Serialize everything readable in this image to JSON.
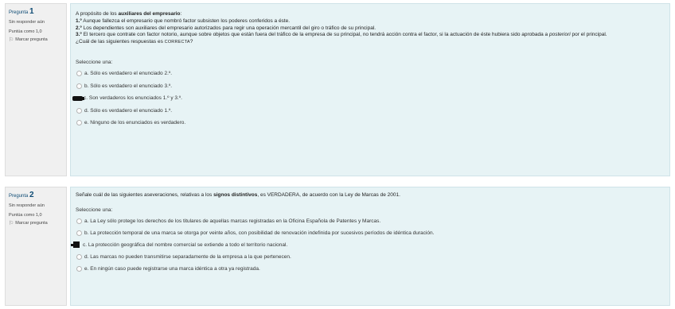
{
  "question1": {
    "number_prefix": "Pregunta",
    "number": "1",
    "status": "Sin responder aún",
    "points": "Puntúa como 1,0",
    "flag_label": "Marcar pregunta",
    "text": {
      "intro_start": "A propósito de los ",
      "intro_bold": "auxiliares del empresario",
      "intro_end": ":",
      "s1_num": "1.º",
      "s1": "  Aunque fallezca el empresario que nombró factor subsisten los poderes conferidos a éste.",
      "s2_num": "2.º",
      "s2": "  Los dependientes son auxiliares del empresario autorizados para regir una operación mercantil del giro o tráfico de su principal.",
      "s3_num": "3.º",
      "s3_a": "  El tercero que contrate con factor notorio, aunque sobre objetos que están fuera del tráfico de la empresa de su principal, no tendrá acción contra el factor, si la actuación de éste hubiera sido aprobada a ",
      "s3_italic": "posteriori",
      "s3_b": " por el principal.",
      "question_start": "¿Cuál de las siguientes respuestas es ",
      "question_caps": "CORRECTA",
      "question_end": "?"
    },
    "prompt": "Seleccione una:",
    "options": [
      "a. Sólo es verdadero el enunciado 2.º.",
      "b. Sólo es verdadero el enunciado 3.º.",
      "c. Son verdaderos los enunciados 1.º y 3.º.",
      "d. Sólo es verdadero el enunciado 1.º.",
      "e. Ninguno de los enunciados es verdadero."
    ]
  },
  "question2": {
    "number_prefix": "Pregunta",
    "number": "2",
    "status": "Sin responder aún",
    "points": "Puntúa como 1,0",
    "flag_label": "Marcar pregunta",
    "text": {
      "start": "Señale cuál de las siguientes aseveraciones, relativas a los ",
      "bold": "signos distintivos",
      "end": ", es VERDADERA, de acuerdo con la Ley de Marcas de 2001."
    },
    "prompt": "Seleccione una:",
    "options": [
      "a. La Ley sólo protege los derechos de los titulares de aquellas marcas registradas en la Oficina Española de Patentes y Marcas.",
      "b. La protección temporal de una marca se otorga por veinte años, con posibilidad de renovación indefinida por sucesivos períodos de idéntica duración.",
      "c. La protección geográfica del nombre comercial se extiende a todo el territorio nacional.",
      "d. Las marcas no pueden transmitirse separadamente de la empresa a la que pertenecen.",
      "e. En ningún caso puede registrarse una marca idéntica a otra ya registrada."
    ]
  },
  "icons": {
    "flag": "⚐"
  }
}
